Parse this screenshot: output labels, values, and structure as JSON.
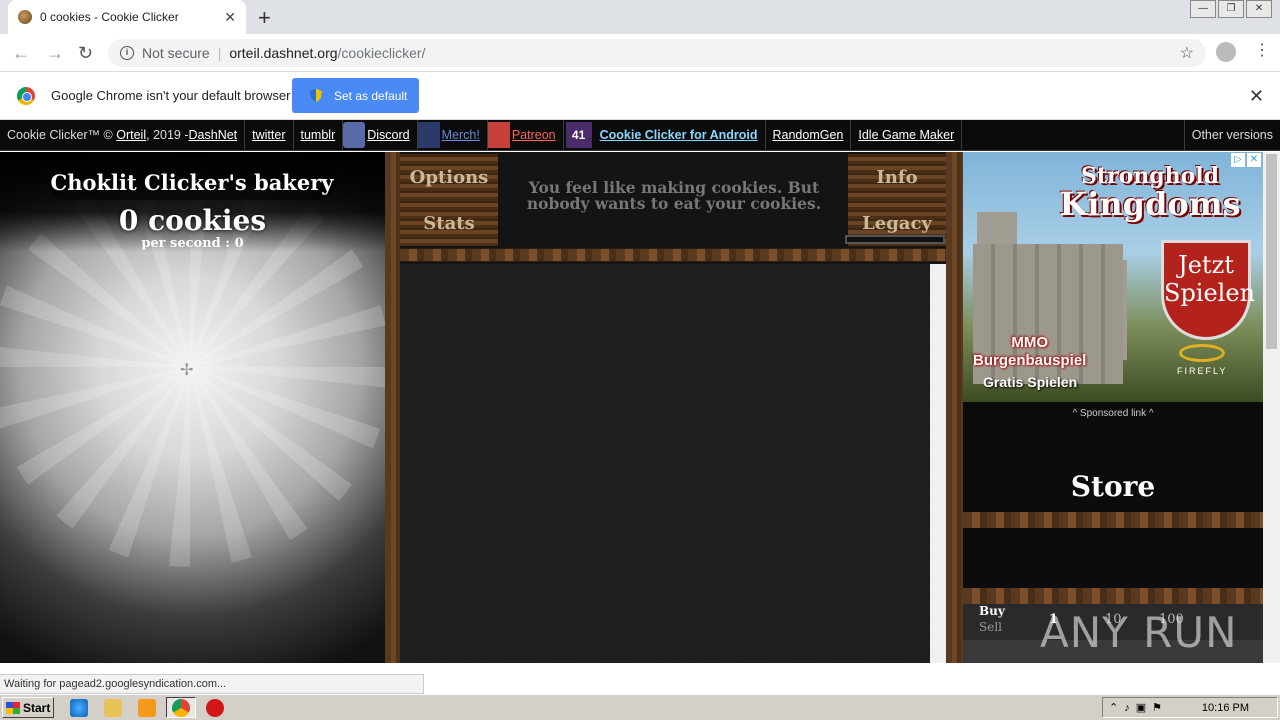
{
  "browser": {
    "tab_title": "0 cookies - Cookie Clicker",
    "not_secure": "Not secure",
    "url_host": "orteil.dashnet.org",
    "url_path": "/cookieclicker/",
    "infobar_message": "Google Chrome isn't your default browser",
    "set_default_label": "Set as default",
    "status_text": "Waiting for pagead2.googlesyndication.com..."
  },
  "topbar": {
    "credit": "Cookie Clicker™ ©",
    "author": "Orteil",
    "year": ", 2019 - ",
    "dashnet": "DashNet",
    "twitter": "twitter",
    "tumblr": "tumblr",
    "discord": "Discord",
    "merch": "Merch!",
    "patreon": "Patreon",
    "android_badge": "41",
    "android": "Cookie Clicker for Android",
    "randomgen": "RandomGen",
    "idle": "Idle Game Maker",
    "other": "Other versions"
  },
  "game": {
    "bakery_name": "Choklit Clicker's bakery",
    "cookies": "0 cookies",
    "per_second": "per second : 0",
    "menu": {
      "options": "Options",
      "stats": "Stats",
      "info": "Info",
      "legacy": "Legacy"
    },
    "flavor_text": "You feel like making cookies. But nobody wants to eat your cookies.",
    "store_title": "Store",
    "buy": "Buy",
    "sell": "Sell",
    "amounts": [
      "1",
      "10",
      "100"
    ]
  },
  "ad": {
    "title_top": "Stronghold",
    "title_bottom": "Kingdoms",
    "jetzt": "Jetzt Spielen",
    "mmo": "MMO",
    "burgen": "Burgenbauspiel",
    "gratis": "Gratis Spielen",
    "brand": "FIREFLY",
    "sponsored": "^ Sponsored link ^"
  },
  "taskbar": {
    "start": "Start",
    "time": "10:16 PM"
  },
  "watermark": "ANY RUN"
}
